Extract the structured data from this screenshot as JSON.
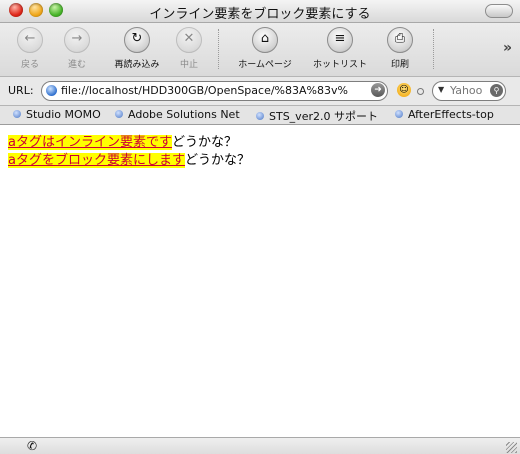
{
  "window": {
    "title": "インライン要素をブロック要素にする"
  },
  "toolbar": {
    "back_label": "戻る",
    "forward_label": "進む",
    "reload_label": "再読み込み",
    "stop_label": "中止",
    "home_label": "ホームページ",
    "hotlist_label": "ホットリスト",
    "print_label": "印刷"
  },
  "addressbar": {
    "url_label": "URL:",
    "url_value": "file://localhost/HDD300GB/OpenSpace/%83A%83v%",
    "search_placeholder": "Yahoo"
  },
  "bookmarks": [
    {
      "label": "Studio MOMO"
    },
    {
      "label": "Adobe Solutions Net"
    },
    {
      "label": "STS_ver2.0 サポート"
    },
    {
      "label": "AfterEffects-top"
    }
  ],
  "content": {
    "line1_link": "aタグはインライン要素です",
    "line1_rest": "どうかな？",
    "line2_link": "aタグをブロック要素にします",
    "line2_rest": "どうかな？"
  },
  "colors": {
    "highlight": "#ffff00",
    "link_text": "#cc0033"
  },
  "icons": {
    "back": "left-arrow-icon",
    "forward": "right-arrow-icon",
    "reload": "reload-icon",
    "stop": "stop-x-icon",
    "home": "home-icon",
    "hotlist": "list-icon",
    "print": "printer-icon"
  }
}
